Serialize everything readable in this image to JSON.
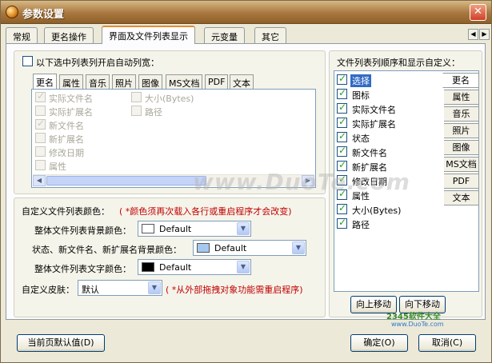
{
  "window": {
    "title": "参数设置",
    "close": "✕"
  },
  "tabs": [
    {
      "label": "常规"
    },
    {
      "label": "更名操作"
    },
    {
      "label": "界面及文件列表显示"
    },
    {
      "label": "元变量"
    },
    {
      "label": "其它"
    }
  ],
  "auto_width": {
    "label": "以下选中列表列开启自动列宽：",
    "checked": false,
    "inner_tabs": [
      "更名",
      "属性",
      "音乐",
      "照片",
      "图像",
      "MS文档",
      "PDF",
      "文本"
    ],
    "left_items": [
      {
        "label": "实际文件名",
        "checked": true
      },
      {
        "label": "实际扩展名",
        "checked": false
      },
      {
        "label": "新文件名",
        "checked": true
      },
      {
        "label": "新扩展名",
        "checked": false
      },
      {
        "label": "修改日期",
        "checked": false
      },
      {
        "label": "属性",
        "checked": false
      }
    ],
    "right_items": [
      {
        "label": "大小(Bytes)",
        "checked": false
      },
      {
        "label": "路径",
        "checked": false
      }
    ]
  },
  "colors": {
    "heading": "自定义文件列表颜色：",
    "note": "( *颜色须再次载入各行或重启程序才会改变)",
    "bg_label": "整体文件列表背景颜色：",
    "bg_value": "Default",
    "bg_swatch": "#ffffff",
    "status_label": "状态、新文件名、新扩展名背景颜色：",
    "status_value": "Default",
    "status_swatch": "#a6c8ef",
    "text_label": "整体文件列表文字颜色：",
    "text_value": "Default",
    "text_swatch": "#000000"
  },
  "skin": {
    "label": "自定义皮肤：",
    "value": "默认",
    "note": "( *从外部拖拽对象功能需重启程序)"
  },
  "order": {
    "heading": "文件列表列顺序和显示自定义：",
    "items": [
      {
        "label": "选择",
        "checked": true,
        "selected": true
      },
      {
        "label": "图标",
        "checked": true
      },
      {
        "label": "实际文件名",
        "checked": true
      },
      {
        "label": "实际扩展名",
        "checked": true
      },
      {
        "label": "状态",
        "checked": true
      },
      {
        "label": "新文件名",
        "checked": true
      },
      {
        "label": "新扩展名",
        "checked": true
      },
      {
        "label": "修改日期",
        "checked": true
      },
      {
        "label": "属性",
        "checked": true
      },
      {
        "label": "大小(Bytes)",
        "checked": true
      },
      {
        "label": "路径",
        "checked": true
      }
    ],
    "side_tabs": [
      "更名",
      "属性",
      "音乐",
      "照片",
      "图像",
      "MS文档",
      "PDF",
      "文本"
    ],
    "move_up": "向上移动",
    "move_down": "向下移动"
  },
  "footer": {
    "defaults": "当前页默认值(D)",
    "ok": "确定(O)",
    "cancel": "取消(C)"
  },
  "watermark": "www.DuoTe.com",
  "corner_logo": "2345软件大全",
  "corner_url": "www.DuoTe.com"
}
